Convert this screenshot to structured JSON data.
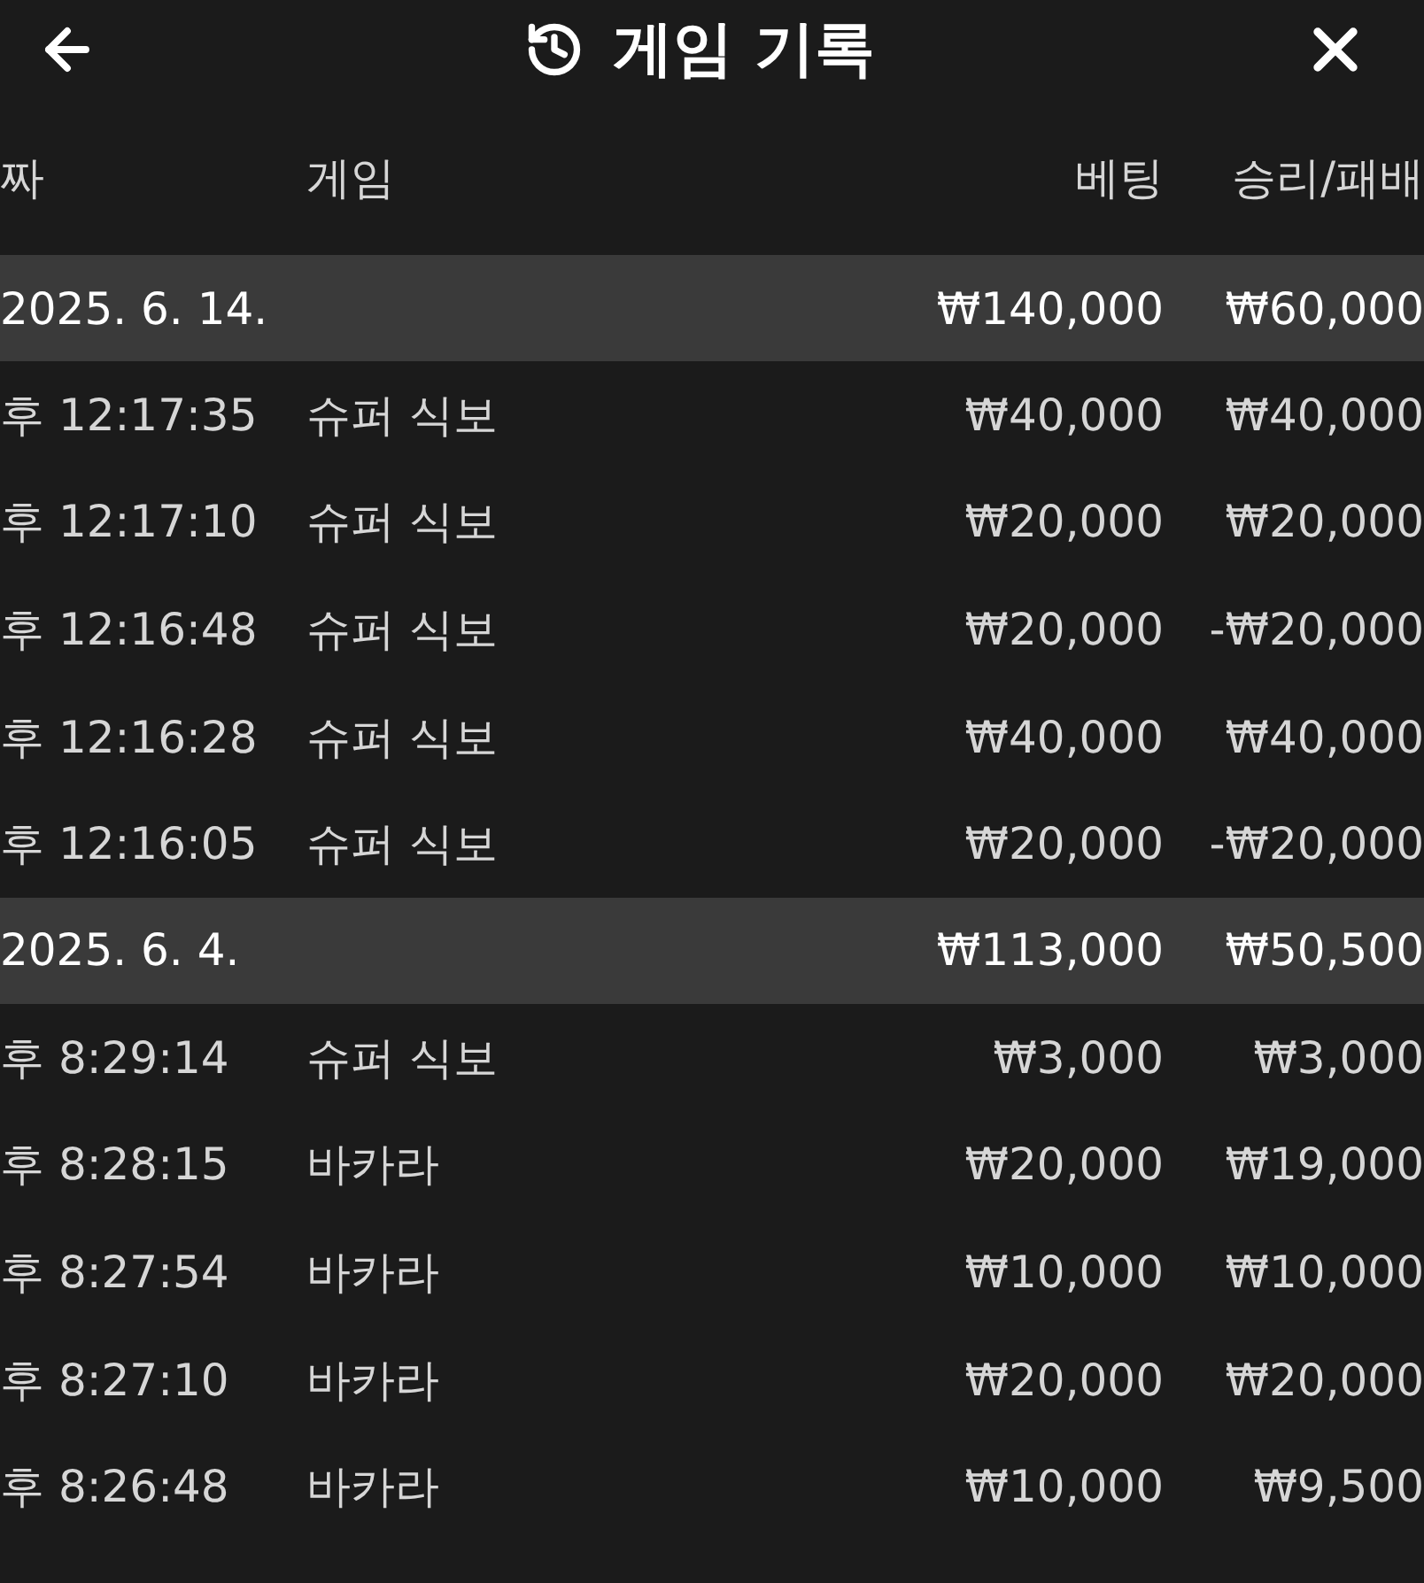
{
  "header": {
    "title": "게임 기록"
  },
  "columns": [
    "짜",
    "게임",
    "베팅",
    "승리/패배"
  ],
  "groups": [
    {
      "date": "2025. 6. 14.",
      "bet": "₩140,000",
      "result": "₩60,000",
      "rows": [
        {
          "time": "후 12:17:35",
          "game": "슈퍼 식보",
          "bet": "₩40,000",
          "result": "₩40,000"
        },
        {
          "time": "후 12:17:10",
          "game": "슈퍼 식보",
          "bet": "₩20,000",
          "result": "₩20,000"
        },
        {
          "time": "후 12:16:48",
          "game": "슈퍼 식보",
          "bet": "₩20,000",
          "result": "-₩20,000"
        },
        {
          "time": "후 12:16:28",
          "game": "슈퍼 식보",
          "bet": "₩40,000",
          "result": "₩40,000"
        },
        {
          "time": "후 12:16:05",
          "game": "슈퍼 식보",
          "bet": "₩20,000",
          "result": "-₩20,000"
        }
      ]
    },
    {
      "date": "2025. 6. 4.",
      "bet": "₩113,000",
      "result": "₩50,500",
      "rows": [
        {
          "time": "후 8:29:14",
          "game": "슈퍼 식보",
          "bet": "₩3,000",
          "result": "₩3,000"
        },
        {
          "time": "후 8:28:15",
          "game": "바카라",
          "bet": "₩20,000",
          "result": "₩19,000"
        },
        {
          "time": "후 8:27:54",
          "game": "바카라",
          "bet": "₩10,000",
          "result": "₩10,000"
        },
        {
          "time": "후 8:27:10",
          "game": "바카라",
          "bet": "₩20,000",
          "result": "₩20,000"
        },
        {
          "time": "후 8:26:48",
          "game": "바카라",
          "bet": "₩10,000",
          "result": "₩9,500"
        }
      ]
    }
  ]
}
